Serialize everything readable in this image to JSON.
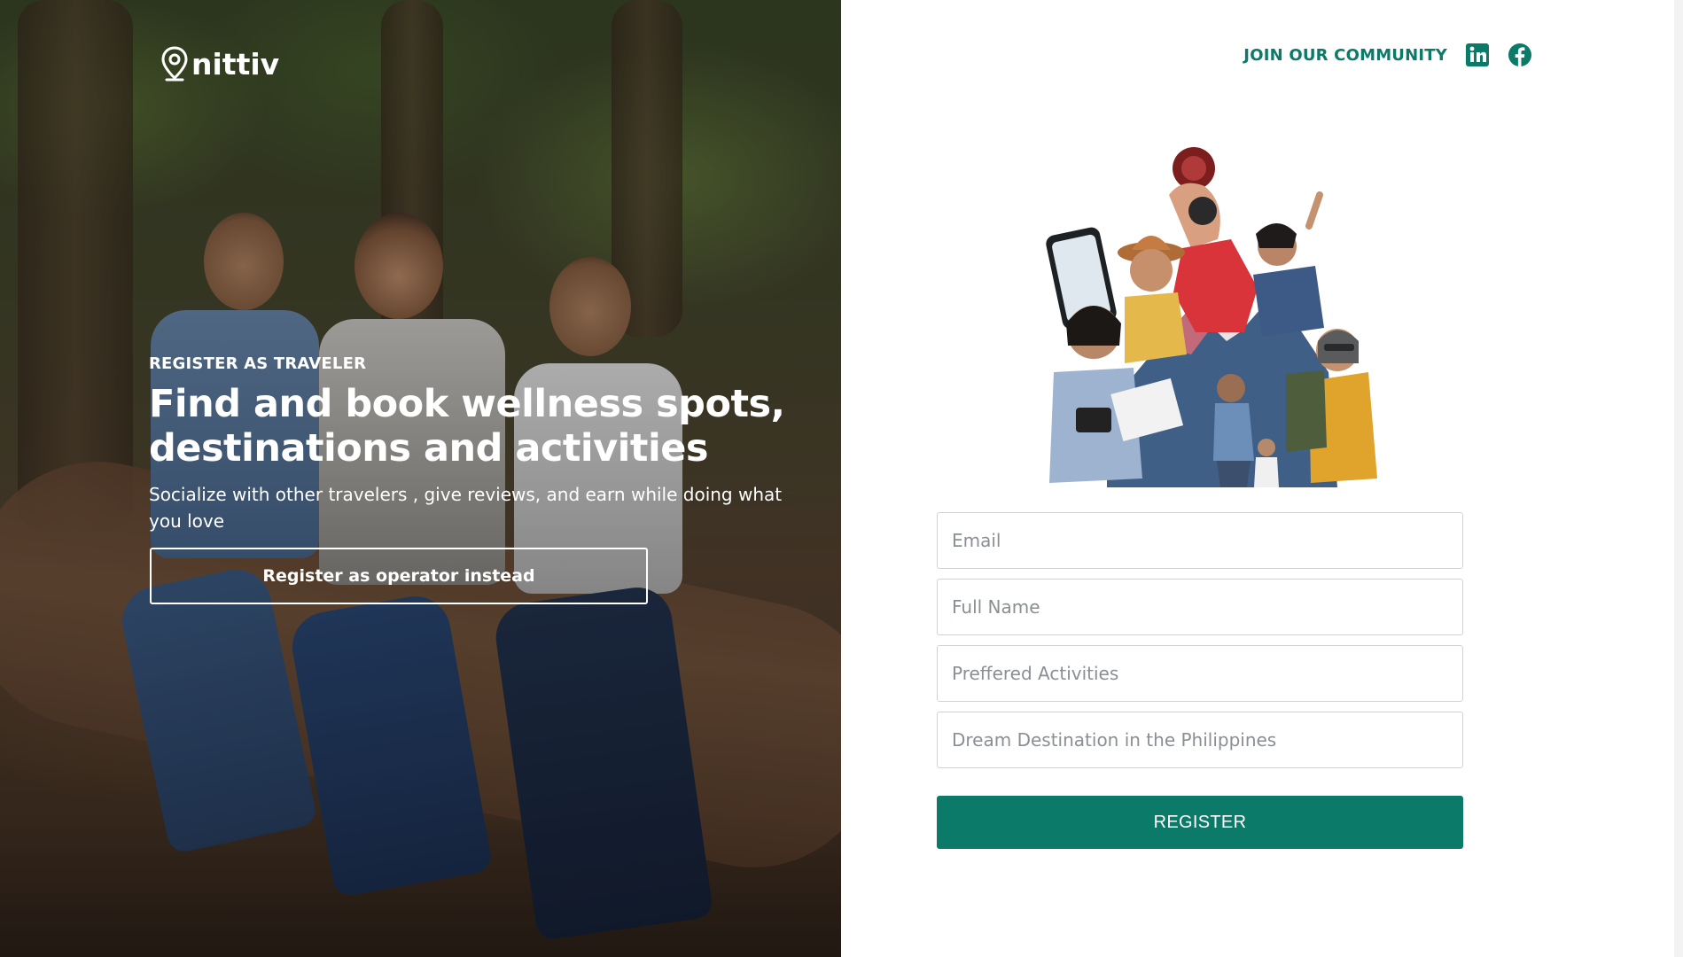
{
  "brand": {
    "name": "nittiv"
  },
  "hero": {
    "eyebrow": "REGISTER AS TRAVELER",
    "headline": "Find and book wellness spots, destinations and activities",
    "subline": "Socialize with other travelers , give reviews, and earn while doing what you love",
    "operator_button_label": "Register as operator instead"
  },
  "header": {
    "community_label": "JOIN OUR COMMUNITY",
    "social_icons": [
      "linkedin-icon",
      "facebook-icon"
    ]
  },
  "form": {
    "email_placeholder": "Email",
    "fullname_placeholder": "Full Name",
    "activities_placeholder": "Preffered Activities",
    "destination_placeholder": "Dream Destination in the Philippines",
    "register_label": "REGISTER"
  },
  "colors": {
    "accent": "#0b7a68",
    "panel_background": "#ffffff",
    "field_border": "#cfd3d6"
  }
}
